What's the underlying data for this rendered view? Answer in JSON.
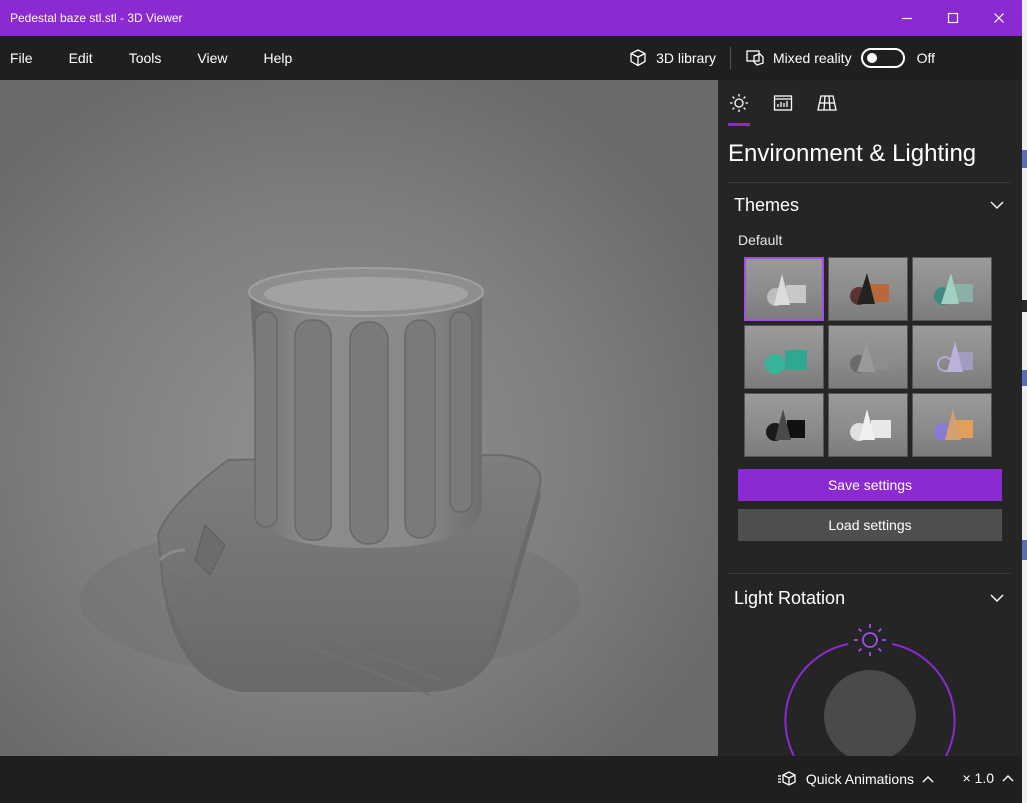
{
  "window": {
    "title": "Pedestal baze stl.stl - 3D Viewer",
    "accent": "#8a2ad0",
    "controls": [
      "minimize-icon",
      "maximize-icon",
      "close-icon"
    ]
  },
  "menubar": {
    "items": [
      {
        "label": "File"
      },
      {
        "label": "Edit"
      },
      {
        "label": "Tools"
      },
      {
        "label": "View"
      },
      {
        "label": "Help"
      }
    ],
    "library_label": "3D library",
    "mixed_reality_label": "Mixed reality",
    "mixed_reality_state": "Off"
  },
  "panel": {
    "tabs": [
      {
        "icon": "sun-icon",
        "selected": true
      },
      {
        "icon": "stats-icon",
        "selected": false
      },
      {
        "icon": "grid-icon",
        "selected": false
      }
    ],
    "title": "Environment & Lighting",
    "themes": {
      "heading": "Themes",
      "current_label": "Default",
      "tiles": [
        {
          "name": "default",
          "selected": true
        },
        {
          "name": "dark-orange",
          "selected": false
        },
        {
          "name": "teal",
          "selected": false
        },
        {
          "name": "green-teal",
          "selected": false
        },
        {
          "name": "grey",
          "selected": false
        },
        {
          "name": "lavender",
          "selected": false
        },
        {
          "name": "black",
          "selected": false
        },
        {
          "name": "white",
          "selected": false
        },
        {
          "name": "purple-orange",
          "selected": false
        }
      ]
    },
    "save_label": "Save settings",
    "load_label": "Load settings",
    "light_rotation": {
      "heading": "Light Rotation"
    }
  },
  "bottombar": {
    "animations_label": "Quick Animations",
    "speed_label": "× 1.0"
  }
}
